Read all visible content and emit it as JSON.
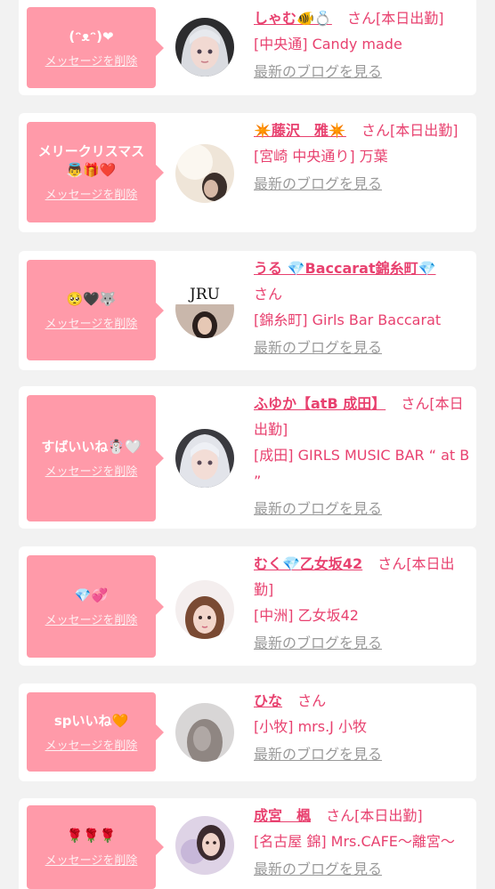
{
  "delete_label": "メッセージを削除",
  "blog_label": "最新のブログを見る",
  "san_label": "さん",
  "colors": {
    "accent": "#e8416f",
    "bubble": "#ff9aa9",
    "link_gray": "#9a9a9a",
    "background": "#f2f2f2"
  },
  "items": [
    {
      "message": "(ᵔᴥᵔ)❤",
      "name": "しゃむ🐠💍",
      "status": "[本日出勤]",
      "shop": "[中央通] Candy made"
    },
    {
      "message": "メリークリスマス👼🎁❤️",
      "name": "✴️藤沢　雅✴️",
      "status": "[本日出勤]",
      "shop": "[宮崎 中央通り] 万葉"
    },
    {
      "message": "🥺🖤🐺",
      "name": "うる 💎Baccarat錦糸町💎",
      "status": "",
      "shop": "[錦糸町] Girls Bar Baccarat"
    },
    {
      "message": "すばいいね☃️🤍",
      "name": "ふゆか【atB 成田】",
      "status": "[本日出勤]",
      "shop": "[成田] GIRLS MUSIC BAR “ at B ”"
    },
    {
      "message": "💎💞",
      "name": "むく💎乙女坂42",
      "status": "[本日出勤]",
      "shop": "[中洲] 乙女坂42"
    },
    {
      "message": "spいいね🧡",
      "name": "ひな",
      "status": "",
      "shop": "[小牧] mrs.J 小牧"
    },
    {
      "message": "🌹🌹🌹",
      "name": "成宮　楓",
      "status": "[本日出勤]",
      "shop": "[名古屋 錦] Mrs.CAFE〜離宮〜"
    }
  ],
  "avatar_logo_text": "JRU"
}
